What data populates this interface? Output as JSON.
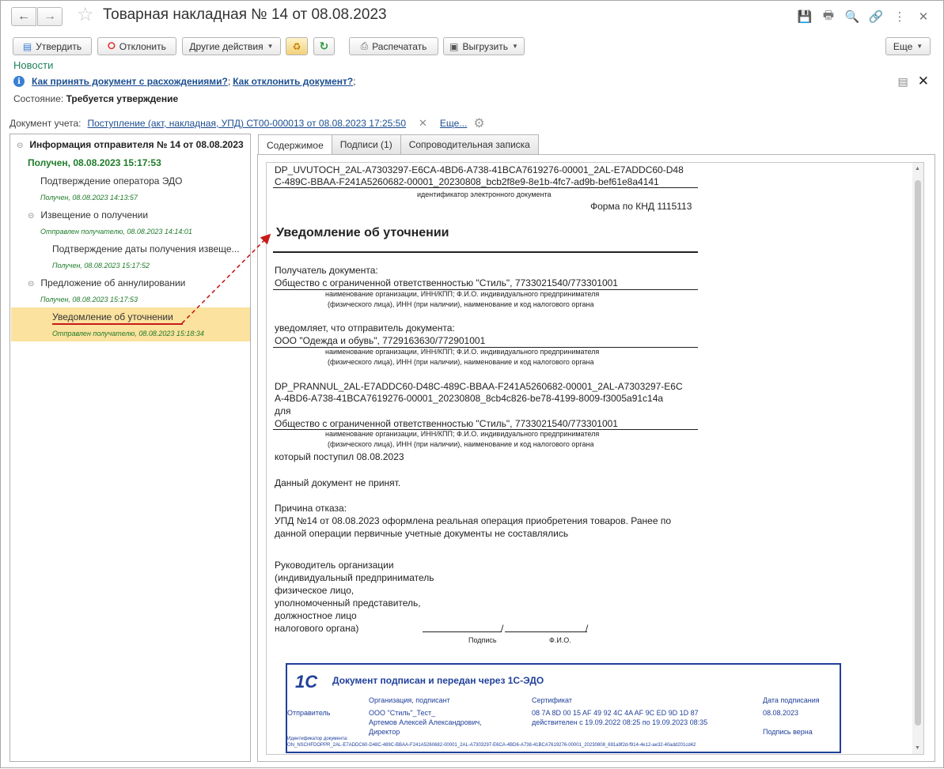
{
  "window": {
    "title": "Товарная накладная № 14 от 08.08.2023",
    "back_icon": "←",
    "forward_icon": "→",
    "favorite_icon": "☆",
    "title_icons": [
      "💾",
      "🖶",
      "🔍",
      "🔗",
      "⋮",
      "✕"
    ]
  },
  "toolbar": {
    "approve": "Утвердить",
    "reject": "Отклонить",
    "other_actions": "Другие действия",
    "print": "Распечатать",
    "export": "Выгрузить",
    "more": "Еще"
  },
  "news": "Новости",
  "help_links": {
    "accept_with_diff": "Как принять документ с расхождениями?",
    "separator": ";",
    "how_to_reject": "Как отклонить документ?",
    "separator2": ";"
  },
  "state": {
    "label": "Состояние:",
    "value": "Требуется утверждение"
  },
  "document_account": {
    "label": "Документ учета:",
    "link": "Поступление (акт, накладная, УПД) СТ00-000013 от 08.08.2023 17:25:50",
    "more": "Еще..."
  },
  "tree": {
    "root": "Информация отправителя № 14 от 08.08.2023",
    "received": "Получен, 08.08.2023 15:17:53",
    "items": [
      {
        "label": "Подтверждение оператора ЭДО",
        "status": "Получен, 08.08.2023 14:13:57"
      },
      {
        "label": "Извещение о получении",
        "status": "Отправлен получателю, 08.08.2023 14:14:01"
      },
      {
        "label": "Подтверждение даты получения извеще...",
        "status": "Получен, 08.08.2023 15:17:52"
      },
      {
        "label": "Предложение об аннулировании",
        "status": "Получен, 08.08.2023 15:17:53"
      },
      {
        "label": "Уведомление об уточнении",
        "status": "Отправлен получателю, 08.08.2023 15:18:34"
      }
    ]
  },
  "tabs": [
    "Содержимое",
    "Подписи (1)",
    "Сопроводительная записка"
  ],
  "doc": {
    "id_line1": "DP_UVUTOCH_2AL-A7303297-E6CA-4BD6-A738-41BCA7619276-00001_2AL-E7ADDC60-D48",
    "id_line2": "C-489C-BBAA-F241A5260682-00001_20230808_bcb2f8e9-8e1b-4fc7-ad9b-bef61e8a4141",
    "id_caption": "идентификатор электронного документа",
    "form": "Форма по КНД 1115113",
    "heading": "Уведомление об уточнении",
    "recipient_label": "Получатель документа:",
    "recipient_value": "Общество с ограниченной ответственностью \"Стиль\", 7733021540/773301001",
    "caption_a": "наименование организации, ИНН/КПП; Ф.И.О. индивидуального предпринимателя",
    "caption_b": "(физического лица), ИНН (при наличии), наименование и код налогового органа",
    "notify_label": "уведомляет, что отправитель документа:",
    "sender_value": "ООО \"Одежда и обувь\", 7729163630/772901001",
    "ref_line1": "DP_PRANNUL_2AL-E7ADDC60-D48C-489C-BBAA-F241A5260682-00001_2AL-A7303297-E6C",
    "ref_line2": "A-4BD6-A738-41BCA7619276-00001_20230808_8cb4c826-be78-4199-8009-f3005a91c14a",
    "for_label": "для",
    "for_value": "Общество с ограниченной ответственностью \"Стиль\", 7733021540/773301001",
    "received_line": "который поступил 08.08.2023",
    "not_accepted": "Данный документ не принят.",
    "reason_label": "Причина отказа:",
    "reason_line1": "УПД №14 от 08.08.2023 оформлена реальная операция приобретения товаров. Ранее по",
    "reason_line2": "данной операции первичные учетные документы не составлялись",
    "signer_lines": [
      "Руководитель  организации",
      "(индивидуальный предприниматель",
      "физическое лицо,",
      "уполномоченный представитель,",
      "должностное лицо",
      "налогового органа)"
    ],
    "sign_slash": "/",
    "sign_end": "/",
    "sign_caption": "Подпись",
    "fio_caption": "Ф.И.О."
  },
  "stamp": {
    "logo": "1С",
    "heading": "Документ подписан и передан через 1С-ЭДО",
    "col_org": "Организация, подписант",
    "col_cert": "Сертификат",
    "col_date": "Дата подписания",
    "row_label": "Отправитель",
    "org_line1": "ООО \"Стиль\"_Тест_",
    "org_line2": "Артемов Алексей Александрович,",
    "org_line3": "Директор",
    "cert_line1": "08 7A 8D 00 15 AF 49 92 4C 4A AF 9C ED 9D 1D 87",
    "cert_line2": "действителен с 19.09.2022 08:25 по 19.09.2023 08:35",
    "date_value": "08.08.2023",
    "sign_valid": "Подпись верна",
    "id_label": "Идентификатор документа:",
    "id_value": "ON_NSCHFDOPPR_2AL-E7ADDC60-D48C-489C-BBAA-F241A5260682-00001_2AL-A7303297-E6CA-4BD6-A738-41BCA7619276-00001_20230808_691a9f2d-f914-4e12-ae32-40add201cd42"
  },
  "colors": {
    "accent_green": "#21825b",
    "link_blue": "#1d4f91",
    "selection": "#fbe29e",
    "stamp_blue": "#1f3f9a",
    "status_green": "#1e7b28"
  }
}
